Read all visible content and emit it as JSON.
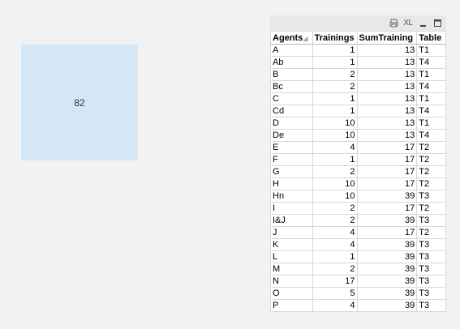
{
  "kpi": {
    "value": "82"
  },
  "caption": {
    "icons": [
      "print-icon",
      "excel-export-icon",
      "minimize-icon",
      "maximize-icon"
    ],
    "xl_label": "XL"
  },
  "table": {
    "headers": [
      "Agents",
      "Trainings",
      "SumTraining",
      "Table"
    ],
    "rows": [
      [
        "A",
        "1",
        "13",
        "T1"
      ],
      [
        "Ab",
        "1",
        "13",
        "T4"
      ],
      [
        "B",
        "2",
        "13",
        "T1"
      ],
      [
        "Bc",
        "2",
        "13",
        "T4"
      ],
      [
        "C",
        "1",
        "13",
        "T1"
      ],
      [
        "Cd",
        "1",
        "13",
        "T4"
      ],
      [
        "D",
        "10",
        "13",
        "T1"
      ],
      [
        "De",
        "10",
        "13",
        "T4"
      ],
      [
        "E",
        "4",
        "17",
        "T2"
      ],
      [
        "F",
        "1",
        "17",
        "T2"
      ],
      [
        "G",
        "2",
        "17",
        "T2"
      ],
      [
        "H",
        "10",
        "17",
        "T2"
      ],
      [
        "Hn",
        "10",
        "39",
        "T3"
      ],
      [
        "I",
        "2",
        "17",
        "T2"
      ],
      [
        "I&J",
        "2",
        "39",
        "T3"
      ],
      [
        "J",
        "4",
        "17",
        "T2"
      ],
      [
        "K",
        "4",
        "39",
        "T3"
      ],
      [
        "L",
        "1",
        "39",
        "T3"
      ],
      [
        "M",
        "2",
        "39",
        "T3"
      ],
      [
        "N",
        "17",
        "39",
        "T3"
      ],
      [
        "O",
        "5",
        "39",
        "T3"
      ],
      [
        "P",
        "4",
        "39",
        "T3"
      ]
    ]
  }
}
